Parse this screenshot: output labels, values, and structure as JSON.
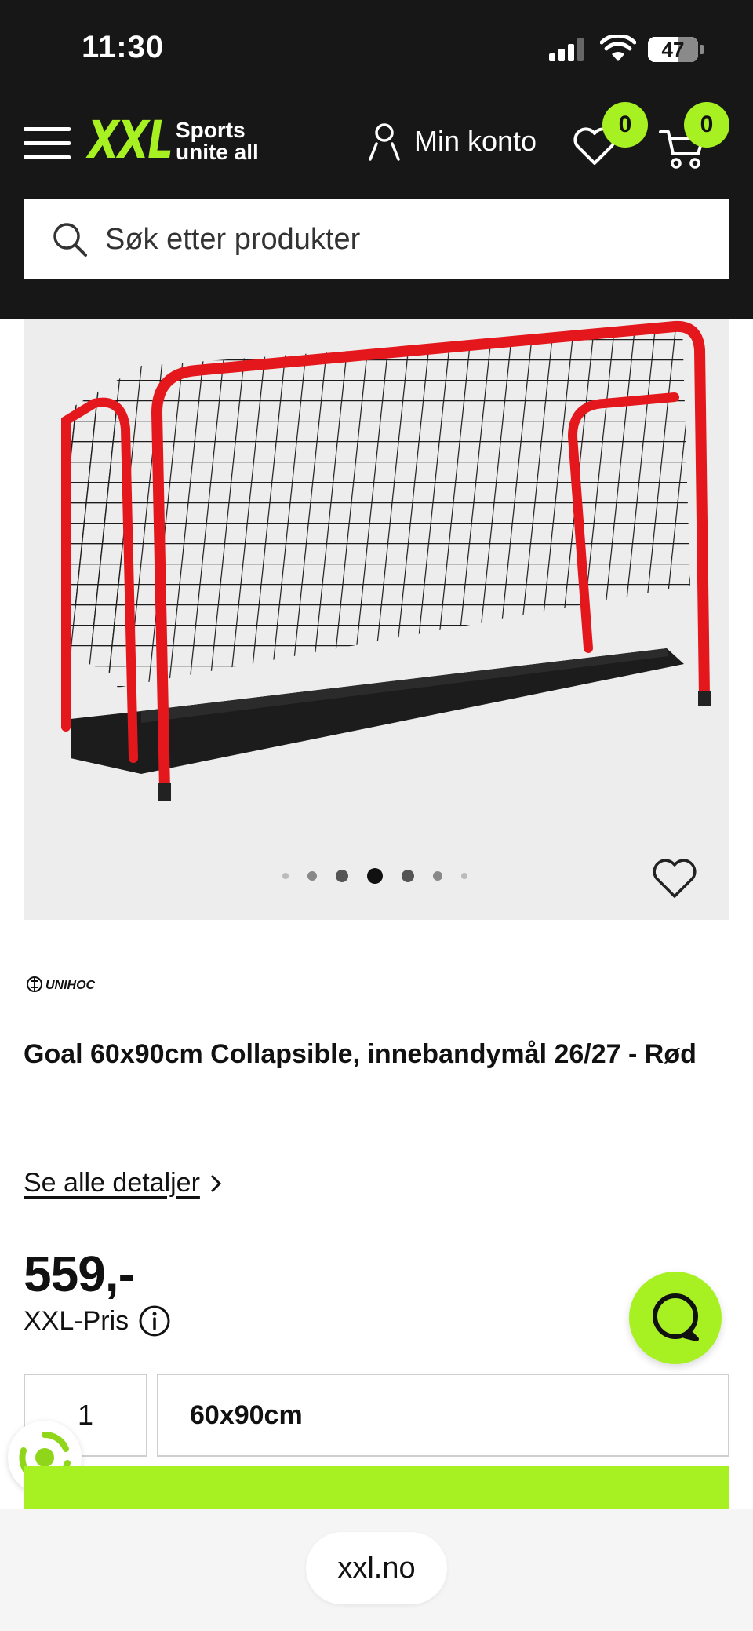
{
  "status": {
    "time": "11:30",
    "battery": "47"
  },
  "header": {
    "logo_text": "XXL",
    "tagline_line1": "Sports",
    "tagline_line2": "unite all",
    "account_label": "Min konto",
    "wishlist_count": "0",
    "cart_count": "0",
    "colors": {
      "header_bg": "#171717",
      "accent": "#a7f123"
    }
  },
  "search": {
    "placeholder": "Søk etter produkter"
  },
  "gallery": {
    "total_images": 7,
    "active_index": 3
  },
  "product": {
    "brand": "UNIHOC",
    "title": "Goal 60x90cm Collapsible, innebandymål 26/27 - Rød",
    "details_link": "Se alle detaljer",
    "price": "559,-",
    "price_label": "XXL-Pris",
    "quantity": "1",
    "size": "60x90cm"
  },
  "browser": {
    "url": "xxl.no"
  }
}
